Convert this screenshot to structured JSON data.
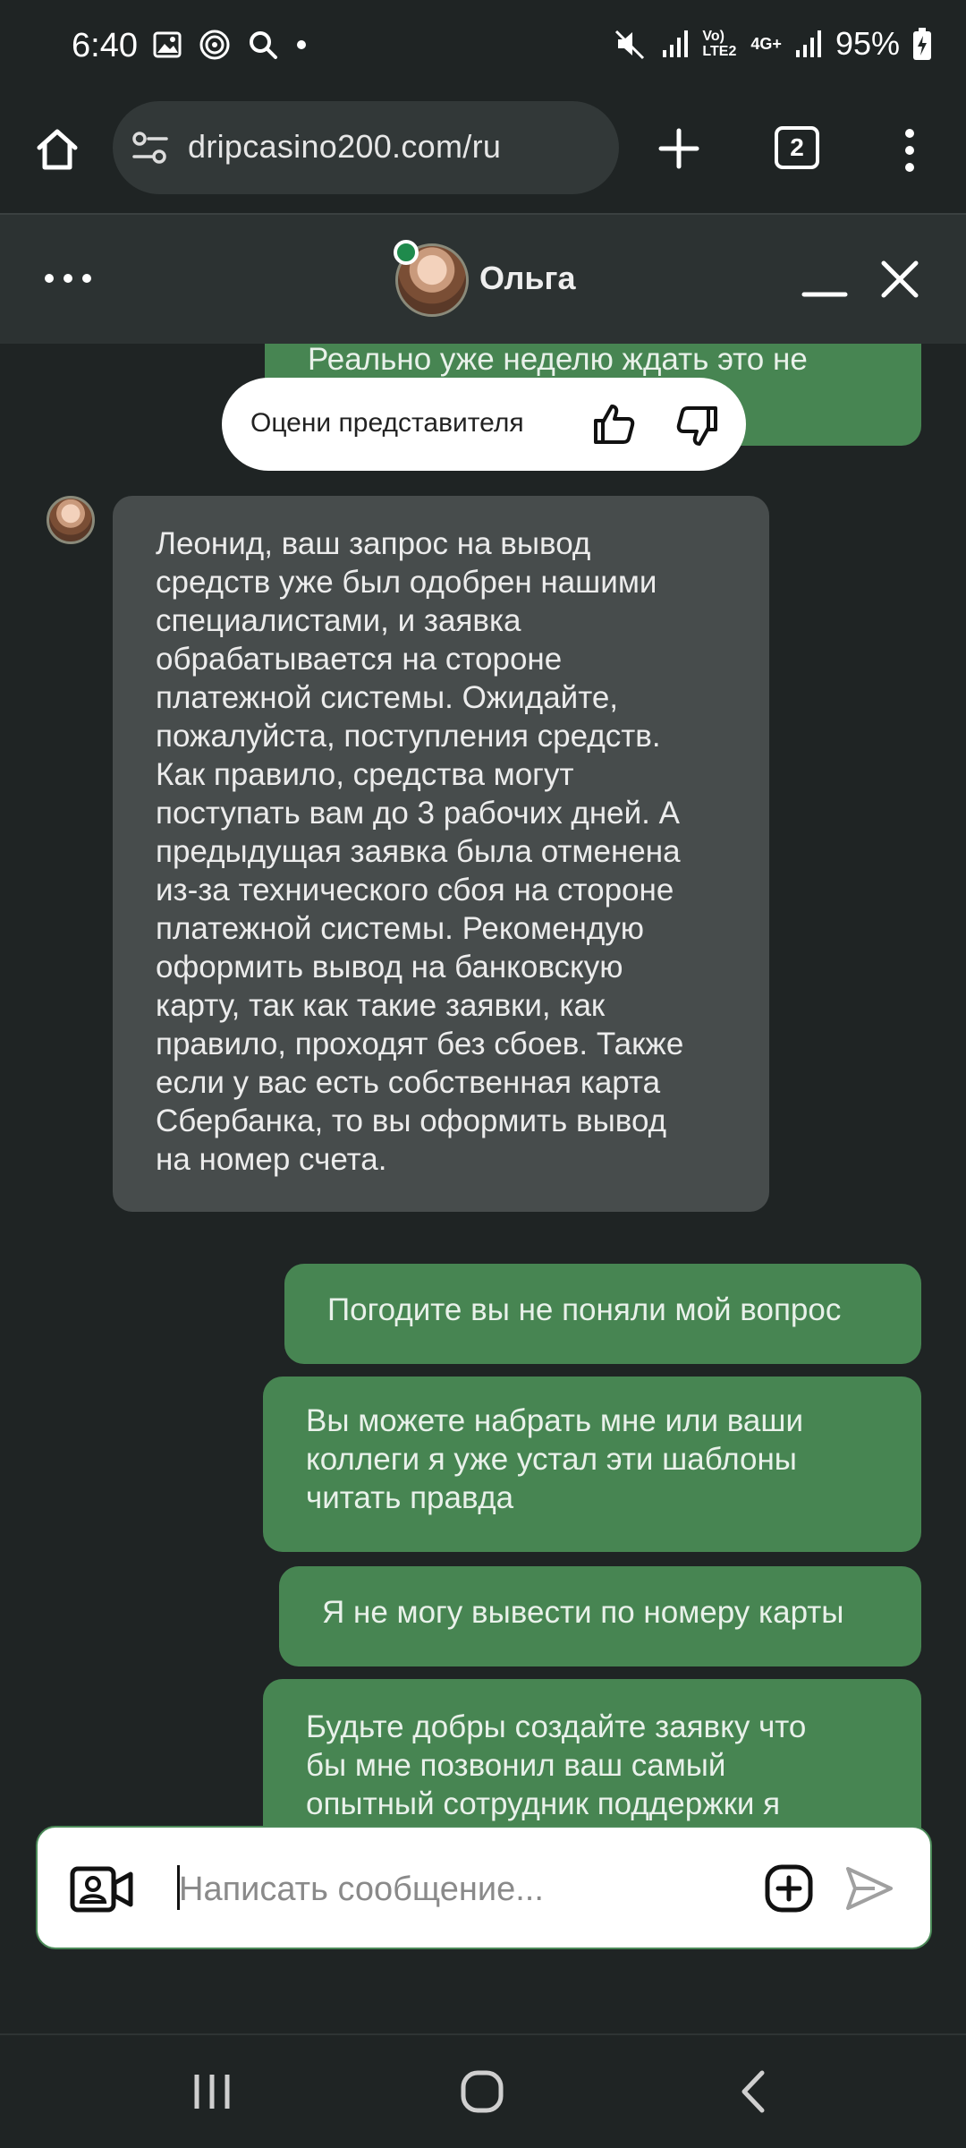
{
  "status_bar": {
    "time": "6:40",
    "network": "Vo) LTE2",
    "network_type": "4G+",
    "battery": "95%"
  },
  "browser": {
    "url": "dripcasino200.com/ru",
    "tab_count": "2"
  },
  "chat_header": {
    "agent_name": "Ольга",
    "online": true
  },
  "rating": {
    "label": "Оцени представителя"
  },
  "messages": [
    {
      "from": "user",
      "text": "Реально уже неделю ждать это не"
    },
    {
      "from": "agent",
      "text": "Леонид, ваш запрос на вывод\nсредств уже был одобрен нашими\nспециалистами, и заявка\nобрабатывается на стороне\nплатежной системы. Ожидайте,\nпожалуйста, поступления средств.\nКак правило, средства могут\nпоступать вам до 3 рабочих дней. А\nпредыдущая заявка была отменена\nиз-за технического сбоя на стороне\nплатежной системы. Рекомендую\nоформить вывод на банковскую\nкарту, так как такие заявки, как\nправило, проходят без сбоев. Также\nесли у вас есть собственная карта\nСбербанка, то вы оформить вывод\nна номер счета."
    },
    {
      "from": "user",
      "text": "Погодите вы не поняли мой вопрос"
    },
    {
      "from": "user",
      "text": "Вы можете набрать мне или ваши\nколлеги я уже устал эти шаблоны\nчитать правда"
    },
    {
      "from": "user",
      "text": "Я не могу вывести по номеру карты"
    },
    {
      "from": "user",
      "text": "Будьте добры создайте заявку что\nбы мне позвонил ваш самый\nопытный сотрудник поддержки я"
    }
  ],
  "composer": {
    "placeholder": "Написать сообщение..."
  },
  "colors": {
    "background": "#1f2424",
    "user_bubble": "#478552",
    "agent_bubble": "#474c4c",
    "header": "#2c3232",
    "online": "#1f8a4c"
  }
}
